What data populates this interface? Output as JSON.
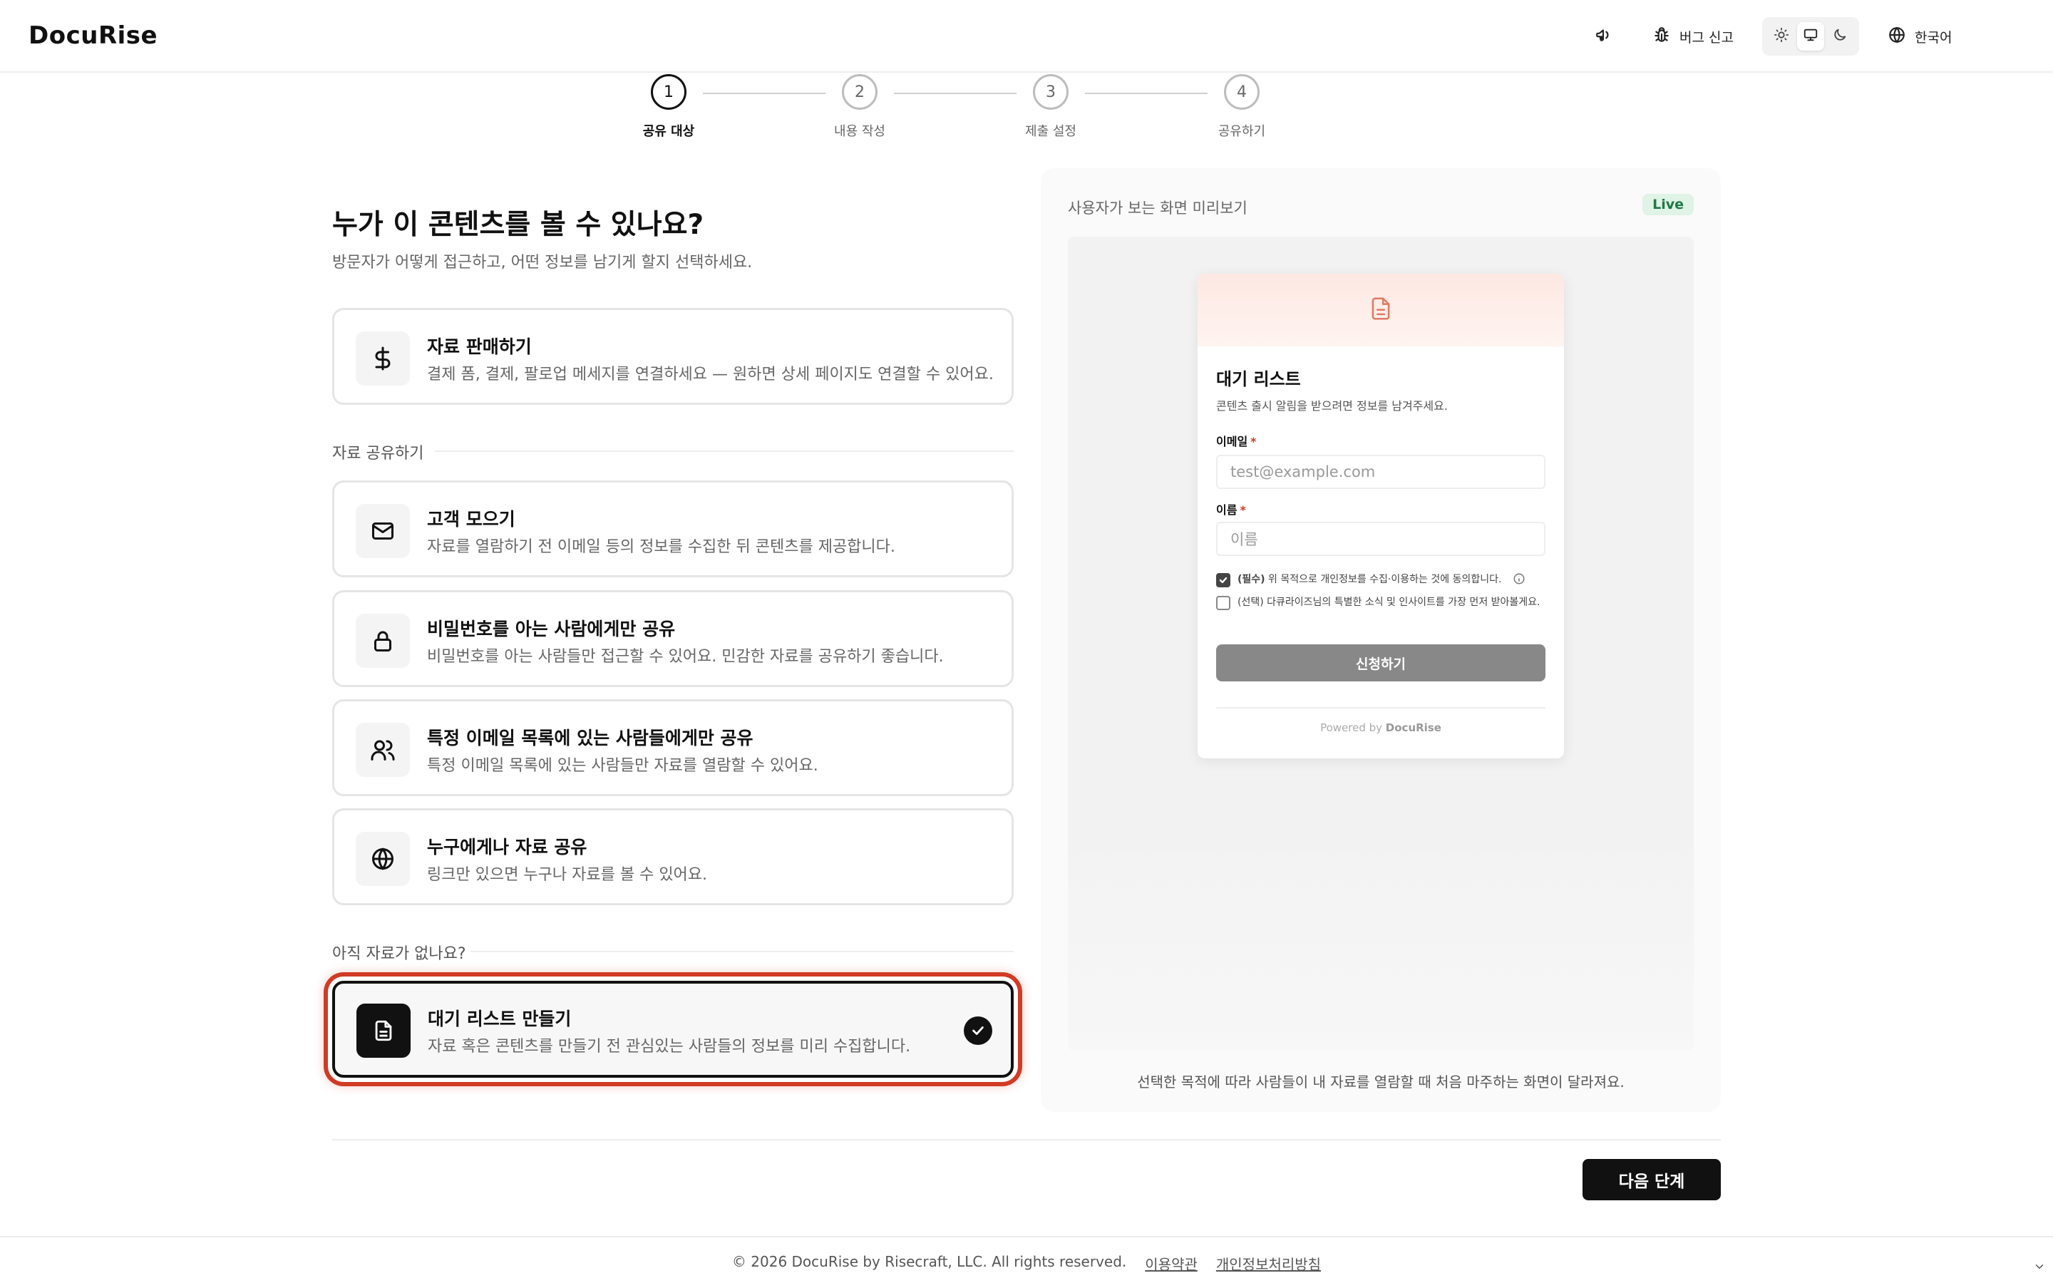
{
  "header": {
    "logo": "DocuRise",
    "bug_report_label": "버그 신고",
    "language_label": "한국어"
  },
  "stepper": {
    "steps": [
      {
        "number": "1",
        "label": "공유 대상",
        "state": "active"
      },
      {
        "number": "2",
        "label": "내용 작성",
        "state": "inactive"
      },
      {
        "number": "3",
        "label": "제출 설정",
        "state": "inactive"
      },
      {
        "number": "4",
        "label": "공유하기",
        "state": "inactive"
      }
    ]
  },
  "main": {
    "title": "누가 이 콘텐츠를 볼 수 있나요?",
    "subtitle": "방문자가 어떻게 접근하고, 어떤 정보를 남기게 할지 선택하세요.",
    "sell_option": {
      "icon": "dollar-icon",
      "title": "자료 판매하기",
      "desc": "결제 폼, 결제, 팔로업 메세지를 연결하세요 — 원하면 상세 페이지도 연결할 수 있어요."
    },
    "share_section_label": "자료 공유하기",
    "share_options": [
      {
        "icon": "mail-icon",
        "title": "고객 모으기",
        "desc": "자료를 열람하기 전 이메일 등의 정보를 수집한 뒤 콘텐츠를 제공합니다."
      },
      {
        "icon": "lock-icon",
        "title": "비밀번호를 아는 사람에게만 공유",
        "desc": "비밀번호를 아는 사람들만 접근할 수 있어요. 민감한 자료를 공유하기 좋습니다."
      },
      {
        "icon": "users-icon",
        "title": "특정 이메일 목록에 있는 사람들에게만 공유",
        "desc": "특정 이메일 목록에 있는 사람들만 자료를 열람할 수 있어요."
      },
      {
        "icon": "globe-icon",
        "title": "누구에게나 자료 공유",
        "desc": "링크만 있으면 누구나 자료를 볼 수 있어요."
      }
    ],
    "no_content_section_label": "아직 자료가 없나요?",
    "waitlist_option": {
      "icon": "document-icon",
      "title": "대기 리스트 만들기",
      "desc": "자료 혹은 콘텐츠를 만들기 전 관심있는 사람들의 정보를 미리 수집합니다.",
      "selected": true
    }
  },
  "preview": {
    "label": "사용자가 보는 화면 미리보기",
    "badge": "Live",
    "caption": "선택한 목적에 따라 사람들이 내 자료를 열람할 때 처음 마주하는 화면이 달라져요.",
    "card": {
      "title": "대기 리스트",
      "subtitle": "콘텐츠 출시 알림을 받으려면 정보를 남겨주세요.",
      "email_label": "이메일",
      "email_placeholder": "test@example.com",
      "name_label": "이름",
      "name_placeholder": "이름",
      "required_mark": "*",
      "consent_required_prefix": "(필수)",
      "consent_required_text": "위 목적으로 개인정보를 수집·이용하는 것에 동의합니다.",
      "consent_optional_text": "(선택) 다큐라이즈님의 특별한 소식 및 인사이트를 가장 먼저 받아볼게요.",
      "submit_label": "신청하기",
      "powered_prefix": "Powered by",
      "powered_brand": "DocuRise"
    }
  },
  "actions": {
    "next_label": "다음 단계"
  },
  "footer": {
    "copyright": "© 2026 DocuRise by Risecraft, LLC. All rights reserved.",
    "terms_label": "이용약관",
    "privacy_label": "개인정보처리방침"
  },
  "colors": {
    "accent": "#111111",
    "highlight_ring": "#d23a24",
    "live_badge_bg": "#dff3e6",
    "live_badge_text": "#1f7a45",
    "card_header_tint": "#fde8e2",
    "submit_button": "#888888"
  }
}
